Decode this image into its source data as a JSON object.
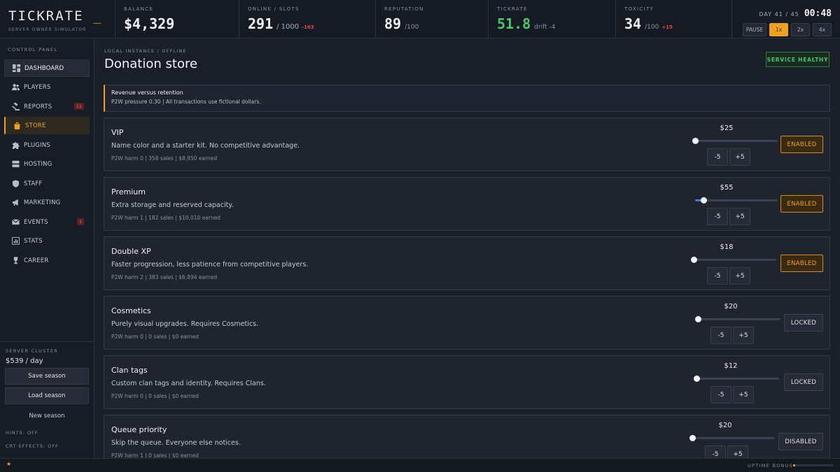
{
  "brand": {
    "title": "TICKRATE",
    "cursor": "_",
    "subtitle": "SERVER OWNER SIMULATOR"
  },
  "stats": {
    "balance": {
      "label": "BALANCE",
      "value": "$4,329"
    },
    "online": {
      "label": "ONLINE / SLOTS",
      "value": "291",
      "sub": "/ 1000",
      "delta": "-163"
    },
    "reputation": {
      "label": "REPUTATION",
      "value": "89",
      "sub": "/100"
    },
    "tickrate": {
      "label": "TICKRATE",
      "value": "51.8",
      "sub": "drift -4"
    },
    "toxicity": {
      "label": "TOXICITY",
      "value": "34",
      "sub": "/100",
      "delta": "+15"
    }
  },
  "clock": {
    "day": "DAY 41 / 45",
    "time": "00:48",
    "speeds": [
      "PAUSE",
      "1x",
      "2x",
      "4x"
    ],
    "active_speed": "1x"
  },
  "sidebar": {
    "section_label": "CONTROL PANEL",
    "items": [
      {
        "label": "DASHBOARD",
        "icon": "dashboard-icon"
      },
      {
        "label": "PLAYERS",
        "icon": "players-icon"
      },
      {
        "label": "REPORTS",
        "icon": "gavel-icon",
        "badge": "11"
      },
      {
        "label": "STORE",
        "icon": "bag-icon"
      },
      {
        "label": "PLUGINS",
        "icon": "puzzle-icon"
      },
      {
        "label": "HOSTING",
        "icon": "server-icon"
      },
      {
        "label": "STAFF",
        "icon": "shield-icon"
      },
      {
        "label": "MARKETING",
        "icon": "megaphone-icon"
      },
      {
        "label": "EVENTS",
        "icon": "mail-icon",
        "badge": "1"
      },
      {
        "label": "STATS",
        "icon": "chart-icon"
      },
      {
        "label": "CAREER",
        "icon": "trophy-icon"
      }
    ],
    "cluster_label": "SERVER CLUSTER",
    "cluster_value": "$539 / day",
    "save_label": "Save season",
    "load_label": "Load season",
    "new_label": "New season",
    "hints": "HINTS: OFF",
    "crt": "CRT EFFECTS: OFF"
  },
  "main": {
    "breadcrumb": "LOCAL INSTANCE / OFFLINE",
    "title": "Donation store",
    "health": "SERVICE HEALTHY",
    "notice_title": "Revenue versus retention",
    "notice_text": "P2W pressure 0.30 | All transactions use fictional dollars."
  },
  "stepper": {
    "minus": "-5",
    "plus": "+5"
  },
  "store_items": [
    {
      "name": "VIP",
      "description": "Name color and a starter kit. No competitive advantage.",
      "meta": "P2W harm 0 | 358 sales | $8,950 earned",
      "price": "$25",
      "state": "ENABLED",
      "slider_fraction": 0.0
    },
    {
      "name": "Premium",
      "description": "Extra storage and reserved capacity.",
      "meta": "P2W harm 1 | 182 sales | $10,010 earned",
      "price": "$55",
      "state": "ENABLED",
      "slider_fraction": 0.1
    },
    {
      "name": "Double XP",
      "description": "Faster progression, less patience from competitive players.",
      "meta": "P2W harm 2 | 383 sales | $6,894 earned",
      "price": "$18",
      "state": "ENABLED",
      "slider_fraction": 0.0
    },
    {
      "name": "Cosmetics",
      "description": "Purely visual upgrades. Requires Cosmetics.",
      "meta": "P2W harm 0 | 0 sales | $0 earned",
      "price": "$20",
      "state": "LOCKED",
      "slider_fraction": 0.0
    },
    {
      "name": "Clan tags",
      "description": "Custom clan tags and identity. Requires Clans.",
      "meta": "P2W harm 0 | 0 sales | $0 earned",
      "price": "$12",
      "state": "LOCKED",
      "slider_fraction": 0.0
    },
    {
      "name": "Queue priority",
      "description": "Skip the queue. Everyone else notices.",
      "meta": "P2W harm 1 | 0 sales | $0 earned",
      "price": "$20",
      "state": "DISABLED",
      "slider_fraction": 0.0
    }
  ],
  "footer": {
    "star": "★",
    "uptime_label": "UPTIME BONUS",
    "uptime_fraction": 0.05
  },
  "colors": {
    "accent": "#f0a020",
    "green": "#4cc76a",
    "red": "#e0454b",
    "slider_blue": "#3e7be0"
  }
}
